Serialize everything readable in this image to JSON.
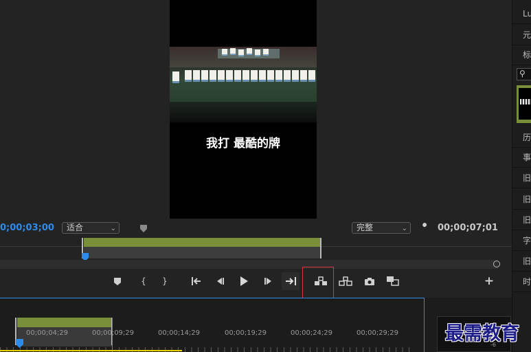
{
  "monitor": {
    "caption": "我打 最酷的牌",
    "current_timecode": "0;00;03;00",
    "zoom_select": "适合",
    "quality_select": "完整",
    "duration_timecode": "00;00;07;01"
  },
  "toolbar": {
    "add_marker_icon": "marker-icon",
    "in_point": "{",
    "out_point": "}",
    "go_to_in": "go-to-in-icon",
    "step_back": "step-back-icon",
    "play": "play-icon",
    "step_forward": "step-forward-icon",
    "go_to_out": "go-to-out-icon",
    "lift": "lift-icon",
    "extract": "extract-icon",
    "export_frame": "camera-icon",
    "compare": "compare-view-icon",
    "add": "+"
  },
  "timeline": {
    "ticks": [
      "00;00;04;29",
      "00;00;09;29",
      "00;00;14;29",
      "00;00;19;29",
      "00;00;24;29",
      "00;00;29;29"
    ],
    "meter_label": "-6"
  },
  "right_panel": {
    "items": [
      "Lu",
      "元",
      "标",
      "",
      "",
      "历",
      "事",
      "旧",
      "旧",
      "旧",
      "字",
      "旧",
      "时"
    ]
  },
  "watermark": "最需教育",
  "colors": {
    "accent_blue": "#2d8ceb",
    "clip_green": "#7a8f3a",
    "highlight_red": "#d9343f",
    "background": "#232323"
  }
}
